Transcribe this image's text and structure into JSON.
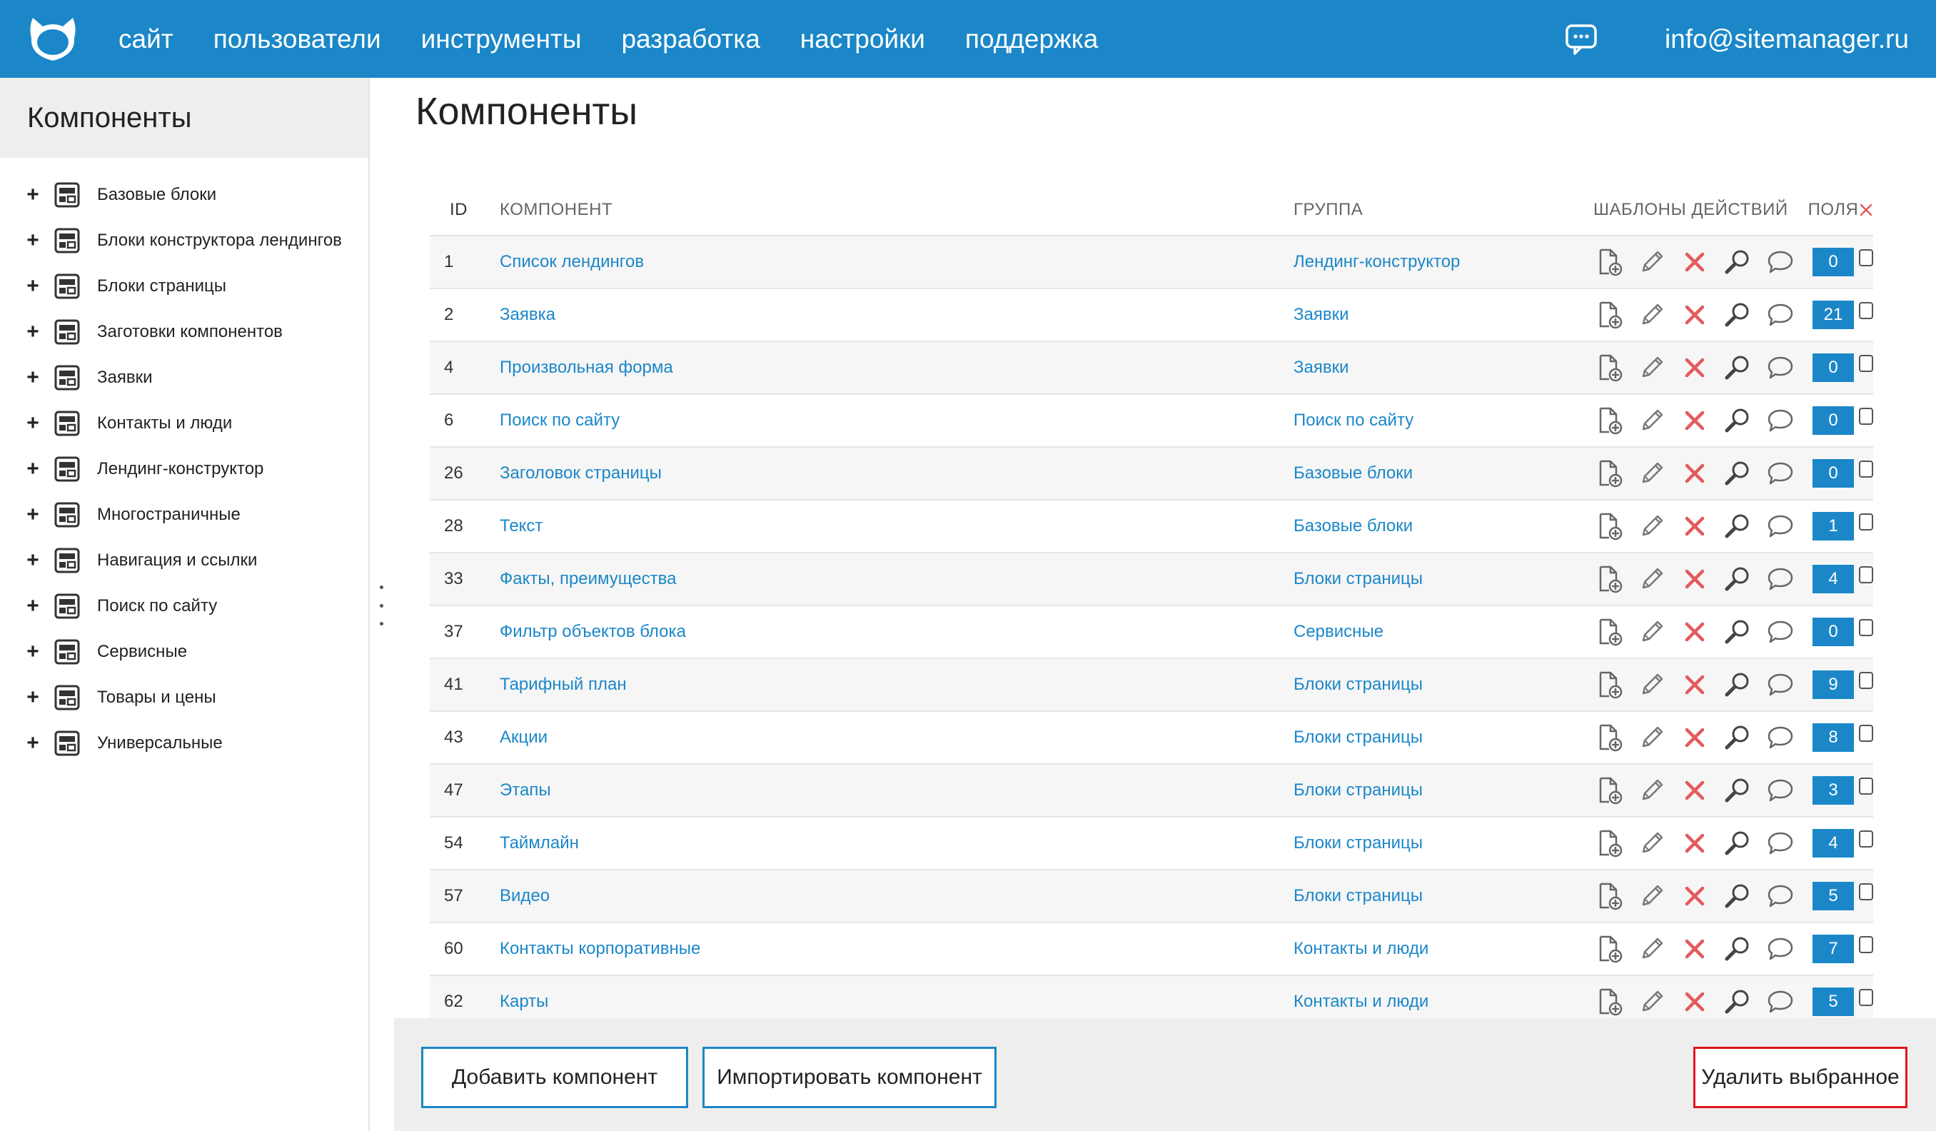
{
  "nav": {
    "items": [
      "сайт",
      "пользователи",
      "инструменты",
      "разработка",
      "настройки",
      "поддержка"
    ],
    "user_email": "info@sitemanager.ru"
  },
  "sidebar": {
    "title": "Компоненты",
    "items": [
      "Базовые блоки",
      "Блоки конструктора лендингов",
      "Блоки страницы",
      "Заготовки компонентов",
      "Заявки",
      "Контакты и люди",
      "Лендинг-конструктор",
      "Многостраничные",
      "Навигация и ссылки",
      "Поиск по сайту",
      "Сервисные",
      "Товары и цены",
      "Универсальные"
    ]
  },
  "main": {
    "title": "Компоненты",
    "columns": {
      "id": "ID",
      "component": "КОМПОНЕНТ",
      "group": "ГРУППА",
      "actions": "ШАБЛОНЫ ДЕЙСТВИЙ",
      "fields": "ПОЛЯ"
    },
    "rows": [
      {
        "id": "1",
        "name": "Список лендингов",
        "group": "Лендинг-конструктор",
        "fields": "0"
      },
      {
        "id": "2",
        "name": "Заявка",
        "group": "Заявки",
        "fields": "21"
      },
      {
        "id": "4",
        "name": "Произвольная форма",
        "group": "Заявки",
        "fields": "0"
      },
      {
        "id": "6",
        "name": "Поиск по сайту",
        "group": "Поиск по сайту",
        "fields": "0"
      },
      {
        "id": "26",
        "name": "Заголовок страницы",
        "group": "Базовые блоки",
        "fields": "0"
      },
      {
        "id": "28",
        "name": "Текст",
        "group": "Базовые блоки",
        "fields": "1"
      },
      {
        "id": "33",
        "name": "Факты, преимущества",
        "group": "Блоки страницы",
        "fields": "4"
      },
      {
        "id": "37",
        "name": "Фильтр объектов блока",
        "group": "Сервисные",
        "fields": "0"
      },
      {
        "id": "41",
        "name": "Тарифный план",
        "group": "Блоки страницы",
        "fields": "9"
      },
      {
        "id": "43",
        "name": "Акции",
        "group": "Блоки страницы",
        "fields": "8"
      },
      {
        "id": "47",
        "name": "Этапы",
        "group": "Блоки страницы",
        "fields": "3"
      },
      {
        "id": "54",
        "name": "Таймлайн",
        "group": "Блоки страницы",
        "fields": "4"
      },
      {
        "id": "57",
        "name": "Видео",
        "group": "Блоки страницы",
        "fields": "5"
      },
      {
        "id": "60",
        "name": "Контакты корпоративные",
        "group": "Контакты и люди",
        "fields": "7"
      },
      {
        "id": "62",
        "name": "Карты",
        "group": "Контакты и люди",
        "fields": "5"
      }
    ]
  },
  "footer": {
    "add_label": "Добавить компонент",
    "import_label": "Импортировать компонент",
    "delete_label": "Удалить выбранное"
  },
  "icons": {
    "row_actions": [
      "add-template-icon",
      "edit-icon",
      "delete-icon",
      "search-icon",
      "comment-icon"
    ],
    "tree": "component-group-icon"
  },
  "colors": {
    "brand": "#1b87c8",
    "delete": "#e35b5b",
    "delete_button_border": "#e0181f"
  }
}
